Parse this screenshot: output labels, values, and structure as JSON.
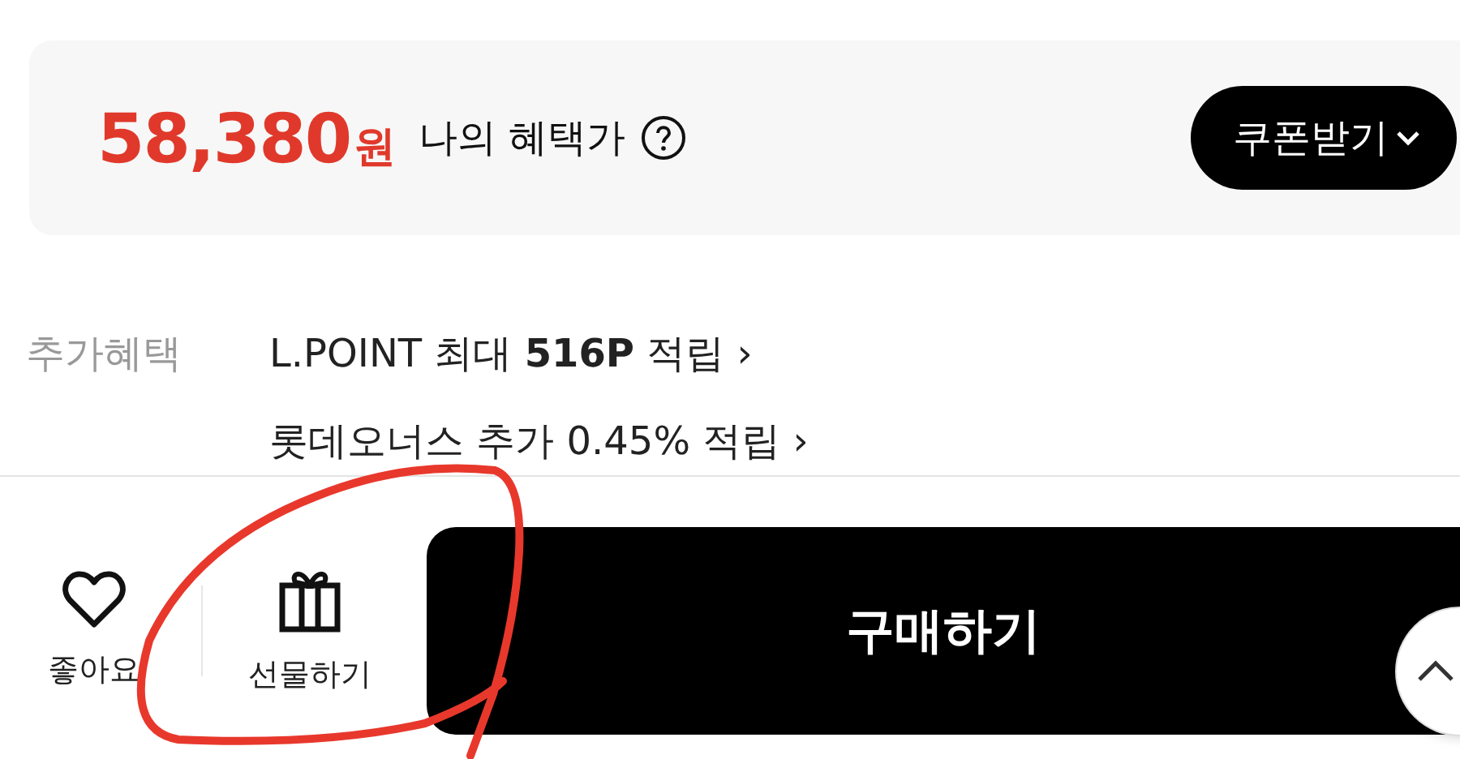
{
  "price_card": {
    "price": "58,380",
    "unit": "원",
    "label": "나의 혜택가",
    "coupon_button": "쿠폰받기"
  },
  "extra_benefits": {
    "label": "추가혜택",
    "lines": [
      "L.POINT 최대 **516P** 적립 ›",
      "롯데오너스 추가 0.45% 적립 ›"
    ]
  },
  "bottom_bar": {
    "actions": [
      {
        "kind": "like",
        "label": "좋아요"
      },
      {
        "kind": "gift",
        "label": "선물하기"
      }
    ],
    "buy_button": "구매하기"
  }
}
